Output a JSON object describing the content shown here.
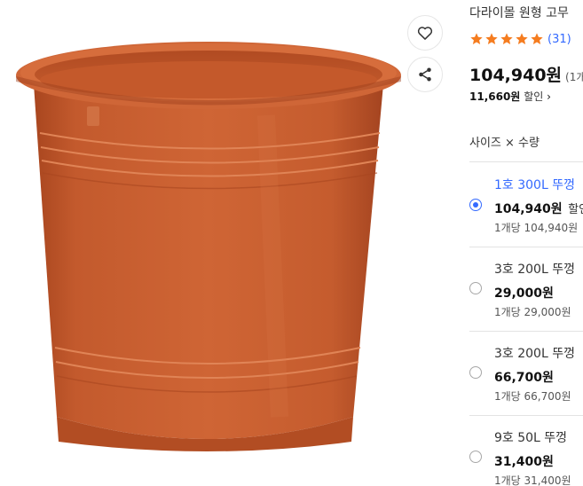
{
  "product": {
    "title": "다라이몰 원형 고무",
    "rating": {
      "stars": 5,
      "review_count": "(31)"
    },
    "price": "104,940원",
    "unit_price_hint": "(1개",
    "discount": {
      "amount": "11,660원",
      "label": "할인",
      "chevron": "›"
    }
  },
  "colors": {
    "accent": "#346aff",
    "star": "#f57c1f",
    "basin": "#c65a2e"
  },
  "icons": [
    "heart-icon",
    "share-icon",
    "star-icon",
    "chevron-right-icon"
  ],
  "options": {
    "header": "사이즈 × 수량",
    "items": [
      {
        "name": "1호 300L 뚜껑",
        "price": "104,940원",
        "tag": "할인",
        "unit": "1개당 104,940원",
        "selected": true
      },
      {
        "name": "3호 200L 뚜껑",
        "price": "29,000원",
        "tag": "",
        "unit": "1개당 29,000원",
        "selected": false
      },
      {
        "name": "3호 200L 뚜껑",
        "price": "66,700원",
        "tag": "",
        "unit": "1개당 66,700원",
        "selected": false
      },
      {
        "name": "9호 50L 뚜껑",
        "price": "31,400원",
        "tag": "",
        "unit": "1개당 31,400원",
        "selected": false
      }
    ]
  }
}
